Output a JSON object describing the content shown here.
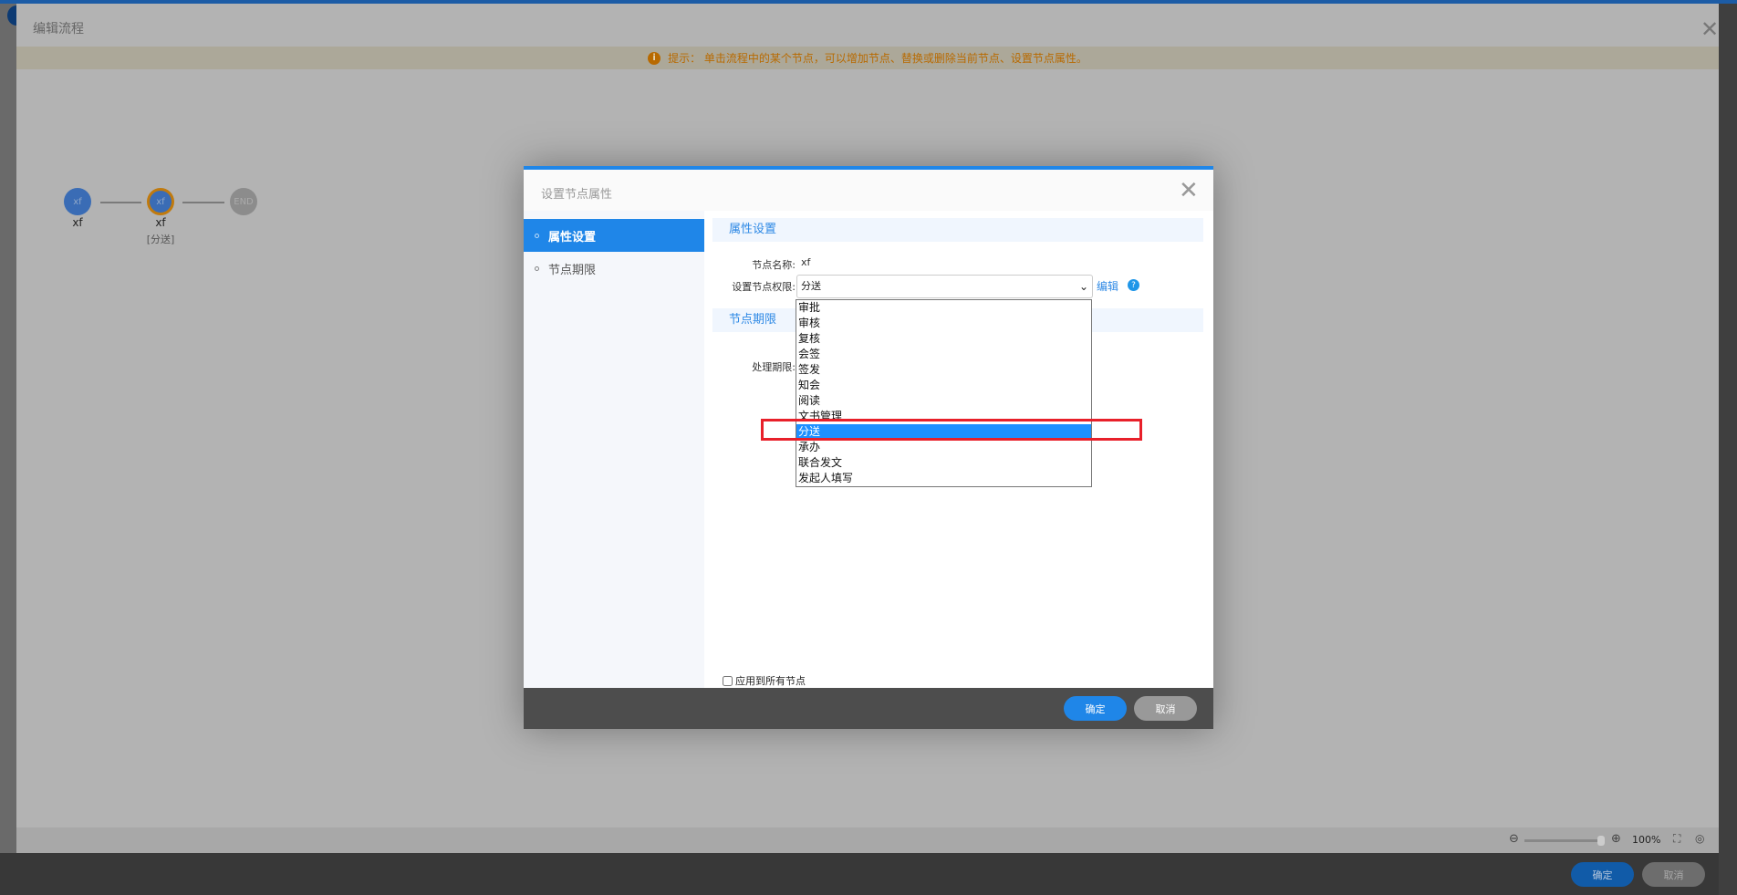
{
  "outer": {
    "title": "编辑流程",
    "hint": "提示： 单击流程中的某个节点，可以增加节点、替换或删除当前节点、设置节点属性。",
    "nodes": [
      {
        "text": "xf",
        "label": "xf",
        "sub": ""
      },
      {
        "text": "xf",
        "label": "xf",
        "sub": "[分送]"
      },
      {
        "text": "END",
        "label": "",
        "sub": ""
      }
    ],
    "zoom": "100%",
    "ok": "确定",
    "cancel": "取消"
  },
  "dialog": {
    "title": "设置节点属性",
    "sidebar": [
      {
        "label": "属性设置",
        "active": true
      },
      {
        "label": "节点期限",
        "active": false
      }
    ],
    "section_props": "属性设置",
    "section_deadline": "节点期限",
    "node_name_label": "节点名称:",
    "node_name": "xf",
    "perm_label": "设置节点权限:",
    "perm_value": "分送",
    "edit": "编辑",
    "help": "?",
    "deadline_label": "处理期限:",
    "options": [
      "审批",
      "审核",
      "复核",
      "会签",
      "签发",
      "知会",
      "阅读",
      "文书管理",
      "分送",
      "承办",
      "联合发文",
      "发起人填写"
    ],
    "selected_option": "分送",
    "apply_all": "应用到所有节点",
    "apply_all_checked": false,
    "ok": "确定",
    "cancel": "取消"
  },
  "colors": {
    "accent": "#1f86e8",
    "highlight": "#1e90ff",
    "annotation": "#e8202a",
    "hint": "#b86a00"
  }
}
